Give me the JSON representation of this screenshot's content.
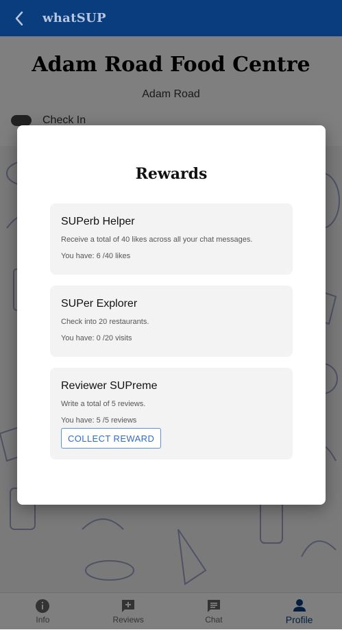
{
  "app": {
    "title": "whatSUP"
  },
  "restaurant": {
    "name": "Adam Road Food Centre",
    "address": "Adam Road",
    "checkin_label": "Check In"
  },
  "modal": {
    "title": "Rewards",
    "rewards": [
      {
        "title": "SUPerb Helper",
        "description": "Receive a total of 40 likes across all your chat messages.",
        "progress": "You have: 6 /40 likes"
      },
      {
        "title": "SUPer Explorer",
        "description": "Check into 20 restaurants.",
        "progress": "You have: 0 /20 visits"
      },
      {
        "title": "Reviewer SUPreme",
        "description": "Write a total of 5 reviews.",
        "progress": "You have: 5 /5 reviews",
        "button": "COLLECT REWARD"
      }
    ]
  },
  "nav": [
    {
      "label": "Info",
      "icon": "info-icon"
    },
    {
      "label": "Reviews",
      "icon": "add-review-icon"
    },
    {
      "label": "Chat",
      "icon": "chat-icon"
    },
    {
      "label": "Profile",
      "icon": "person-icon",
      "active": true
    }
  ],
  "colors": {
    "primary": "#0a3d7e",
    "accent_button": "#2f6ac4"
  }
}
